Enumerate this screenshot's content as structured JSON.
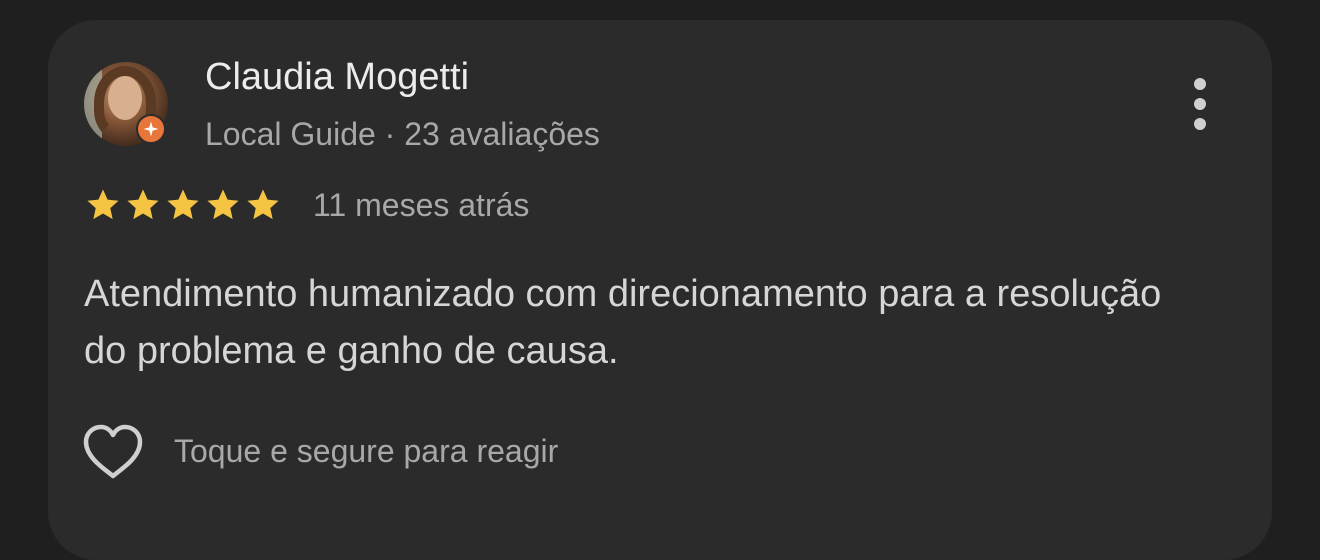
{
  "review": {
    "author": {
      "name": "Claudia Mogetti",
      "subtitle": "Local Guide · 23 avaliações",
      "badge_icon": "local-guide-star-icon",
      "avatar": "profile-photo"
    },
    "rating": 5,
    "rating_max": 5,
    "time_ago": "11 meses atrás",
    "text": "Atendimento humanizado com direcionamento para a resolução do problema e ganho de causa.",
    "reaction_hint": "Toque e segure para reagir",
    "more_icon": "more-vertical-icon",
    "reaction_icon": "heart-outline-icon"
  },
  "colors": {
    "background": "#1f1f1f",
    "card": "#2b2b2b",
    "star": "#f6c443",
    "badge": "#e8753a",
    "primary_text": "#ececec",
    "secondary_text": "#a8a8a8"
  }
}
